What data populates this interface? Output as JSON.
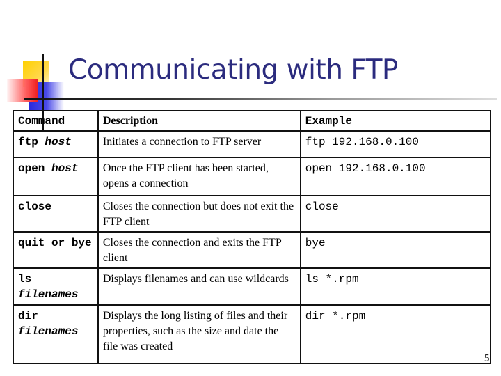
{
  "slide": {
    "title": "Communicating with FTP",
    "page_number": "5"
  },
  "table": {
    "headers": {
      "command": "Command",
      "description": "Description",
      "example": "Example"
    },
    "rows": [
      {
        "cmd": "ftp",
        "arg": "host",
        "description": "Initiates a connection to FTP server",
        "example": "ftp 192.168.0.100"
      },
      {
        "cmd": "open",
        "arg": "host",
        "description": "Once the FTP client has been started, opens a connection",
        "example": "open 192.168.0.100"
      },
      {
        "cmd": "close",
        "arg": "",
        "description": "Closes the connection but does not exit the FTP client",
        "example": "close"
      },
      {
        "cmd": "quit or bye",
        "arg": "",
        "description": "Closes the connection and exits the FTP client",
        "example": "bye"
      },
      {
        "cmd": "ls",
        "arg": "filenames",
        "description": "Displays filenames and can use wildcards",
        "example": "ls *.rpm"
      },
      {
        "cmd": "dir",
        "arg": "filenames",
        "description": "Displays the long listing of files and their properties, such as the size and date the file was created",
        "example": "dir *.rpm"
      }
    ]
  },
  "colors": {
    "title": "#2b2b7e",
    "accent_yellow": "#ffd000",
    "accent_blue": "#2a2adc",
    "accent_red": "#ee1c1c"
  }
}
